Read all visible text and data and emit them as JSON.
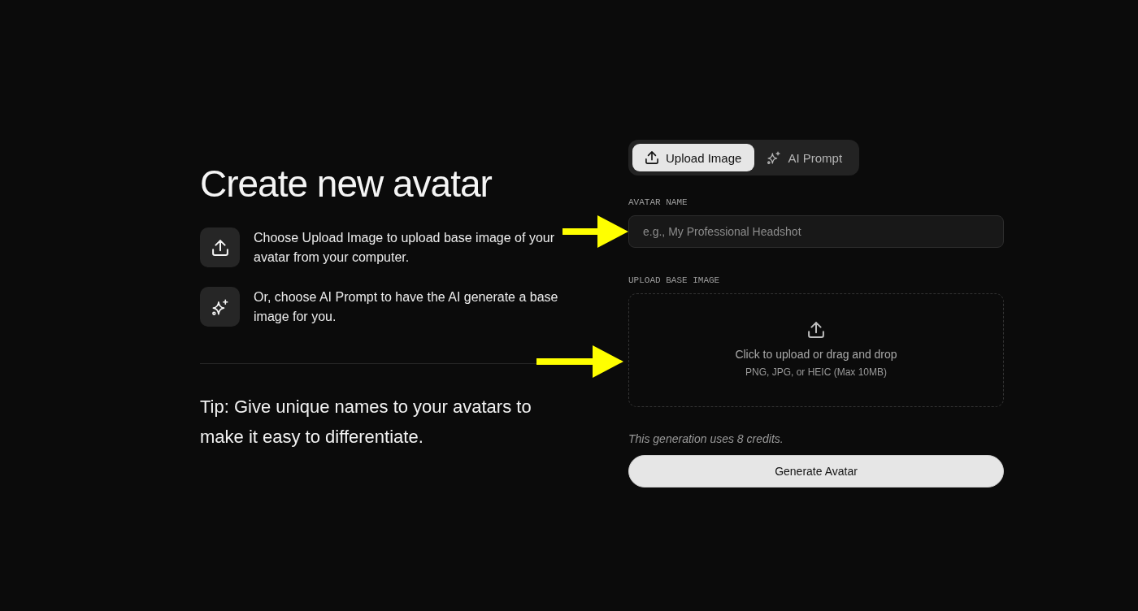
{
  "heading": "Create new avatar",
  "steps": [
    {
      "kind": "upload",
      "text": "Choose Upload Image to upload base image of your avatar from your computer."
    },
    {
      "kind": "sparkle",
      "text": "Or, choose AI Prompt to have the AI generate a base image for you."
    }
  ],
  "tip": "Tip: Give unique names to your avatars to make it easy to differentiate.",
  "mode_tabs": [
    {
      "kind": "upload",
      "label": "Upload Image",
      "selected": true
    },
    {
      "kind": "sparkle",
      "label": "AI Prompt",
      "selected": false
    }
  ],
  "avatar_name": {
    "label": "AVATAR NAME",
    "placeholder": "e.g., My Professional Headshot",
    "arrow": true
  },
  "upload_base_image": {
    "label": "UPLOAD BASE IMAGE",
    "prompt": "Click to upload or drag and drop",
    "formats": "PNG, JPG, or HEIC (Max 10MB)",
    "arrow": true
  },
  "credits_note": "This generation uses 8 credits.",
  "generate_button": "Generate Avatar"
}
